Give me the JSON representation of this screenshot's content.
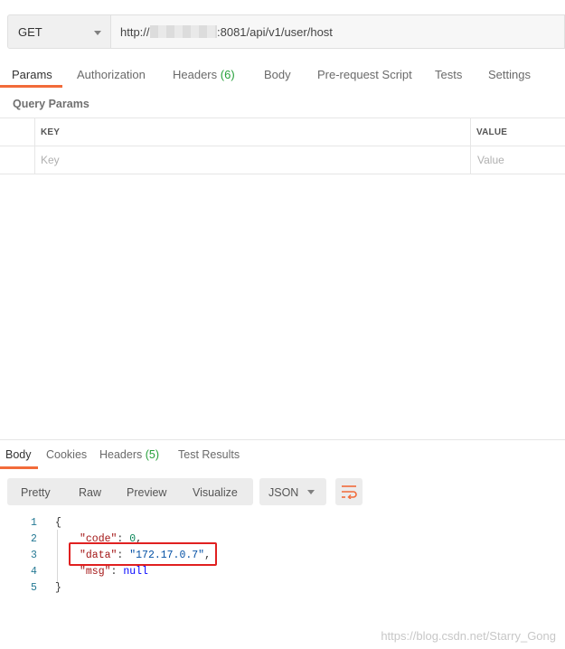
{
  "request": {
    "method": "GET",
    "url_prefix": "http://",
    "url_suffix": ":8081/api/v1/user/host"
  },
  "request_tabs": {
    "params": "Params",
    "authorization": "Authorization",
    "headers": "Headers",
    "headers_count": "(6)",
    "body": "Body",
    "prerequest": "Pre-request Script",
    "tests": "Tests",
    "settings": "Settings"
  },
  "query_params": {
    "title": "Query Params",
    "col_key": "KEY",
    "col_value": "VALUE",
    "key_placeholder": "Key",
    "value_placeholder": "Value"
  },
  "response_tabs": {
    "body": "Body",
    "cookies": "Cookies",
    "headers": "Headers",
    "headers_count": "(5)",
    "test_results": "Test Results"
  },
  "view_modes": {
    "pretty": "Pretty",
    "raw": "Raw",
    "preview": "Preview",
    "visualize": "Visualize",
    "format": "JSON"
  },
  "response_body": {
    "line_numbers": [
      "1",
      "2",
      "3",
      "4",
      "5"
    ],
    "open_brace": "{",
    "close_brace": "}",
    "code_key": "\"code\"",
    "code_value": "0",
    "data_key": "\"data\"",
    "data_value": "\"172.17.0.7\"",
    "msg_key": "\"msg\"",
    "msg_value": "null"
  },
  "watermark": "https://blog.csdn.net/Starry_Gong",
  "colors": {
    "accent": "#f26b3a",
    "count_green": "#26a03a",
    "highlight_red": "#e02020"
  }
}
